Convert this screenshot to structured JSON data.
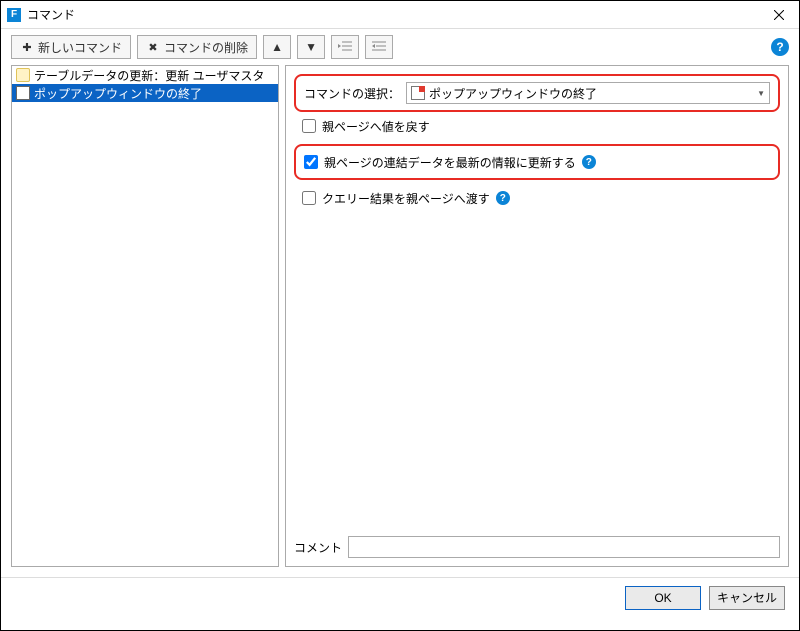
{
  "window": {
    "title": "コマンド",
    "appIconLetter": "F"
  },
  "toolbar": {
    "new_command": "新しいコマンド",
    "delete_command": "コマンドの削除",
    "up": "▲",
    "down": "▼"
  },
  "tree": {
    "items": [
      {
        "label": "テーブルデータの更新：更新 ユーザマスタ",
        "selected": false,
        "icon": "db"
      },
      {
        "label": "ポップアップウィンドウの終了",
        "selected": true,
        "icon": "win"
      }
    ]
  },
  "panel": {
    "command_select_label": "コマンドの選択：",
    "command_value": "ポップアップウィンドウの終了",
    "options": [
      {
        "label": "親ページへ値を戻す",
        "checked": false,
        "help": false,
        "highlight": false
      },
      {
        "label": "親ページの連結データを最新の情報に更新する",
        "checked": true,
        "help": true,
        "highlight": true
      },
      {
        "label": "クエリー結果を親ページへ渡す",
        "checked": false,
        "help": true,
        "highlight": false
      }
    ],
    "comment_label": "コメント",
    "comment_value": ""
  },
  "footer": {
    "ok": "OK",
    "cancel": "キャンセル"
  }
}
